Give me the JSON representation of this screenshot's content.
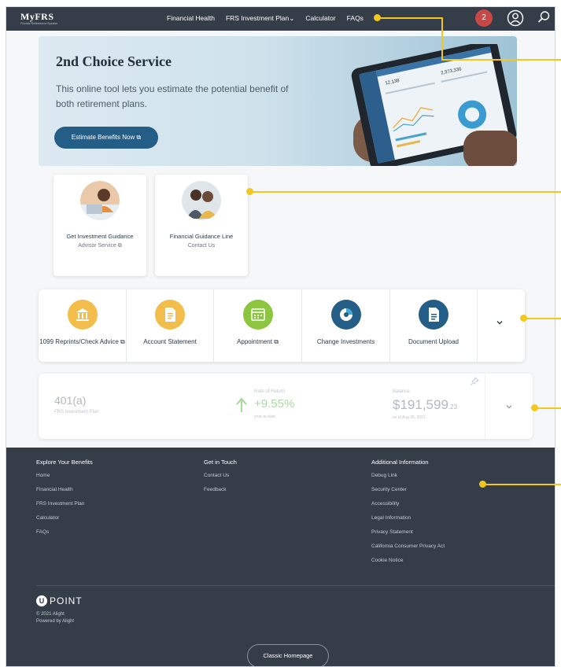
{
  "nav": {
    "logo_brand": "MyFRS",
    "logo_tag": "Florida Retirement System",
    "links": [
      "Financial Health",
      "FRS Investment Plan",
      "Calculator",
      "FAQs"
    ],
    "plan_dropdown_caret": "⌄",
    "notification_count": "2"
  },
  "hero": {
    "title": "2nd Choice Service",
    "description": "This online tool lets you estimate the potential benefit of both retirement plans.",
    "cta_label": "Estimate Benefits Now",
    "tablet_value_1": "12,138",
    "tablet_value_2": "2,373,336"
  },
  "guidance": [
    {
      "title": "Get Investment Guidance",
      "subtitle": "Advisor Service"
    },
    {
      "title": "Financial Guidance Line",
      "subtitle": "Contact Us"
    }
  ],
  "actions": [
    {
      "label": "1099 Reprints/Check Advice",
      "icon": "bank-icon",
      "color": "#f2bd4a"
    },
    {
      "label": "Account Statement",
      "icon": "document-icon",
      "color": "#f2bd4a"
    },
    {
      "label": "Appointment",
      "icon": "calendar-icon",
      "color": "#8cc63f"
    },
    {
      "label": "Change Investments",
      "icon": "pie-icon",
      "color": "#245d86"
    },
    {
      "label": "Document Upload",
      "icon": "upload-document-icon",
      "color": "#245d86"
    }
  ],
  "account": {
    "plan_name": "401(a)",
    "plan_sub": "FRS Investment Plan",
    "ror_label": "Rate of Return",
    "ror_value": "+9.55%",
    "ror_sub": "year-to-date",
    "balance_label": "Balance",
    "balance_main": "$191,599",
    "balance_cents": ".23",
    "balance_date": "as of Aug 26, 2021"
  },
  "footer": {
    "col1": {
      "heading": "Explore Your Benefits",
      "links": [
        "Home",
        "Financial Health",
        "FRS Investment Plan",
        "Calculator",
        "FAQs"
      ]
    },
    "col2": {
      "heading": "Get in Touch",
      "links": [
        "Contact Us",
        "Feedback"
      ]
    },
    "col3": {
      "heading": "Additional Information",
      "links": [
        "Debug Link",
        "Security Center",
        "Accessibility",
        "Legal Information",
        "Privacy Statement",
        "California Consumer Privacy Act",
        "Cookie Notice"
      ]
    },
    "brand": "POINT",
    "copyright": "© 2021 Alight",
    "powered": "Powered by Alight",
    "classic_label": "Classic Homepage"
  },
  "colors": {
    "nav_bg": "#343d48",
    "accent_blue": "#245d86",
    "callout": "#f3c81e",
    "notification": "#c74846"
  }
}
